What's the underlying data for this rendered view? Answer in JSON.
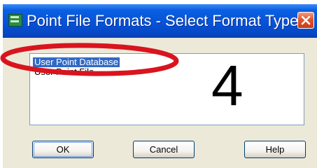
{
  "dialog": {
    "title": "Point File Formats - Select Format Type",
    "close_icon": "close-icon",
    "title_icon": "point-file-icon"
  },
  "list": {
    "items": [
      "User Point Database",
      "User Point File"
    ],
    "selected_index": 0
  },
  "annotation": {
    "step_number": "4",
    "highlight_color": "#d9141e"
  },
  "buttons": {
    "ok": "OK",
    "cancel": "Cancel",
    "help": "Help"
  },
  "colors": {
    "titlebar": "#0653d9",
    "selection": "#316ac5",
    "dialog_face": "#ece9d8",
    "close_button": "#e2542d"
  }
}
